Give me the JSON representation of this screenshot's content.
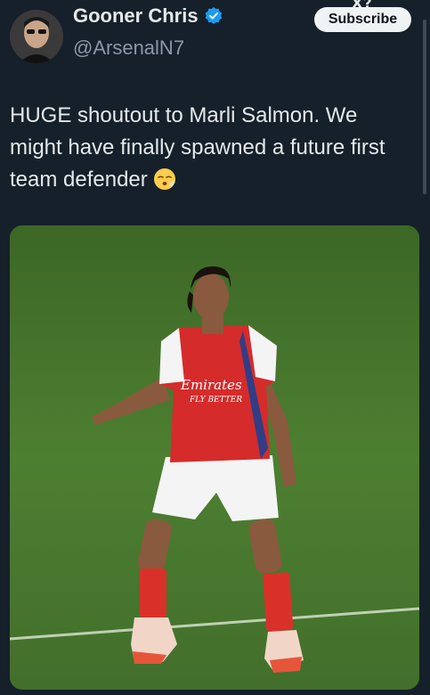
{
  "header": {
    "top_clip_text": "X?",
    "display_name": "Gooner Chris",
    "handle": "@ArsenalN7",
    "subscribe_label": "Subscribe"
  },
  "tweet": {
    "text": "HUGE shoutout to Marli Salmon. We might have finally spawned a future first team defender",
    "emoji": "face-exhaling-emoji"
  },
  "media": {
    "shirt_sponsor_line1": "Emirates",
    "shirt_sponsor_line2": "FLY BETTER"
  },
  "colors": {
    "background": "#15202b",
    "pitch": "#4a7a30",
    "kit_red": "#d52b2b",
    "verified_blue": "#1d9bf0"
  }
}
